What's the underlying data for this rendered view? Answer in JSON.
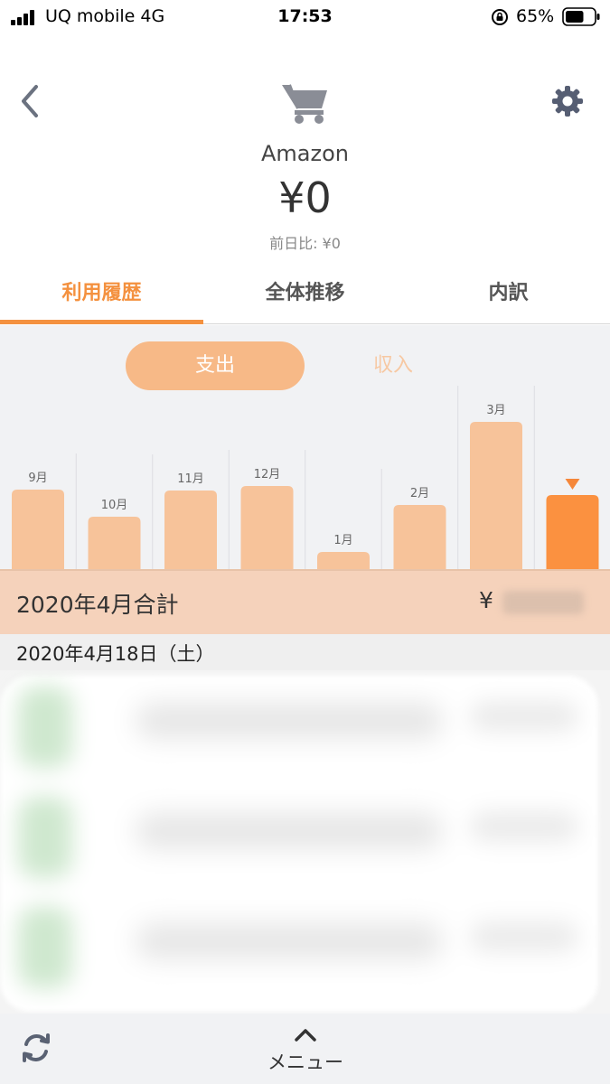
{
  "status_bar": {
    "carrier": "UQ mobile  4G",
    "time": "17:53",
    "battery_percent": "65%",
    "battery_level": 0.65
  },
  "header": {
    "back_icon": "chevron-left-icon",
    "category_icon": "shopping-cart-icon",
    "settings_icon": "gear-icon",
    "account_name": "Amazon",
    "balance": "¥0",
    "previous_day_diff": "前日比: ¥0"
  },
  "tabs": [
    {
      "label": "利用履歴",
      "active": true
    },
    {
      "label": "全体推移",
      "active": false
    },
    {
      "label": "内訳",
      "active": false
    }
  ],
  "chart_toggle": {
    "expense_label": "支出",
    "income_label": "収入",
    "selected": "expense"
  },
  "chart_data": {
    "type": "bar",
    "categories": [
      "9月",
      "10月",
      "11月",
      "12月",
      "1月",
      "2月",
      "3月",
      ""
    ],
    "values": [
      88,
      58,
      87,
      92,
      19,
      71,
      163,
      82
    ],
    "highlighted_index": 7,
    "colors": {
      "bar": "#f7c39a",
      "highlight": "#fb9140",
      "marker": "#f5873a"
    },
    "title": "",
    "xlabel": "",
    "ylabel": ""
  },
  "month_summary": {
    "label": "2020年4月合計",
    "currency": "¥"
  },
  "date_group": {
    "label": "2020年4月18日（土）"
  },
  "bottom_bar": {
    "refresh_icon": "refresh-icon",
    "menu_icon": "chevron-up-icon",
    "menu_label": "メニュー"
  },
  "colors": {
    "accent": "#f4913f",
    "chart_bg": "#f1f2f4",
    "summary_bg": "#f5d2bb"
  }
}
